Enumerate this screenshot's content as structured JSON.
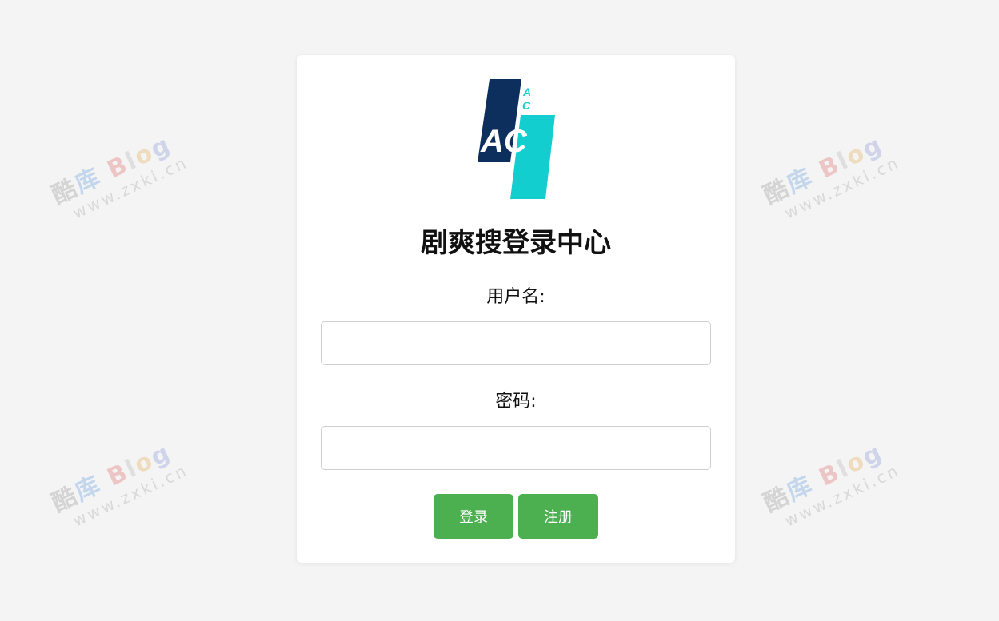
{
  "watermark": {
    "brand_chars": [
      "酷",
      "库",
      "B",
      "l",
      "o",
      "g"
    ],
    "domain": "www.zxki.cn"
  },
  "logo": {
    "big_text": "AC",
    "small_a": "A",
    "small_c": "C",
    "colors": {
      "navy": "#0d2f5e",
      "teal": "#12cece"
    }
  },
  "login": {
    "title": "剧爽搜登录中心",
    "username_label": "用户名:",
    "username_value": "",
    "password_label": "密码:",
    "password_value": "",
    "login_button": "登录",
    "register_button": "注册"
  },
  "colors": {
    "page_bg": "#f4f4f4",
    "card_bg": "#ffffff",
    "button_green": "#4caf50"
  }
}
